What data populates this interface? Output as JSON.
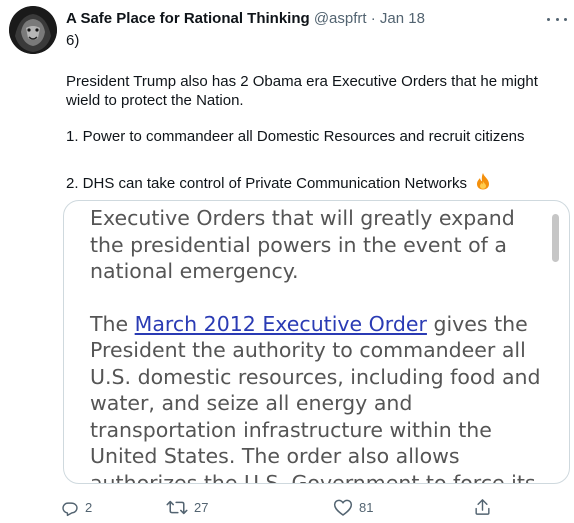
{
  "tweet": {
    "author_name": "A Safe Place for Rational Thinking",
    "author_handle": "@aspfrt",
    "separator": "·",
    "date": "Jan 18",
    "number": "6)",
    "paragraph1": "President Trump also has 2 Obama era Executive Orders that he might wield to protect the Nation.",
    "item1": "1. Power to commandeer all Domestic Resources and recruit citizens",
    "item2": "2. DHS can take control of Private Communication Networks",
    "emoji": "fire-emoji"
  },
  "card": {
    "heading": "Executive Orders that will greatly expand the presidential powers in the event of a national emergency.",
    "body_pre": "The ",
    "body_link": "March 2012 Executive Order",
    "body_post": " gives the President the authority to commandeer all U.S. domestic resources, including food and water, and seize all energy and transportation infrastructure within the United States. The order also allows authorizes the U.S. Government to force its"
  },
  "actions": {
    "reply_count": "2",
    "retweet_count": "27",
    "like_count": "81"
  },
  "icons": {
    "reply": "reply-icon",
    "retweet": "retweet-icon",
    "like": "heart-icon",
    "share": "share-icon",
    "more": "more-icon"
  },
  "colors": {
    "text": "#0f1419",
    "secondary": "#536471",
    "link": "#2a3bb4",
    "fire": "#f4900c"
  }
}
